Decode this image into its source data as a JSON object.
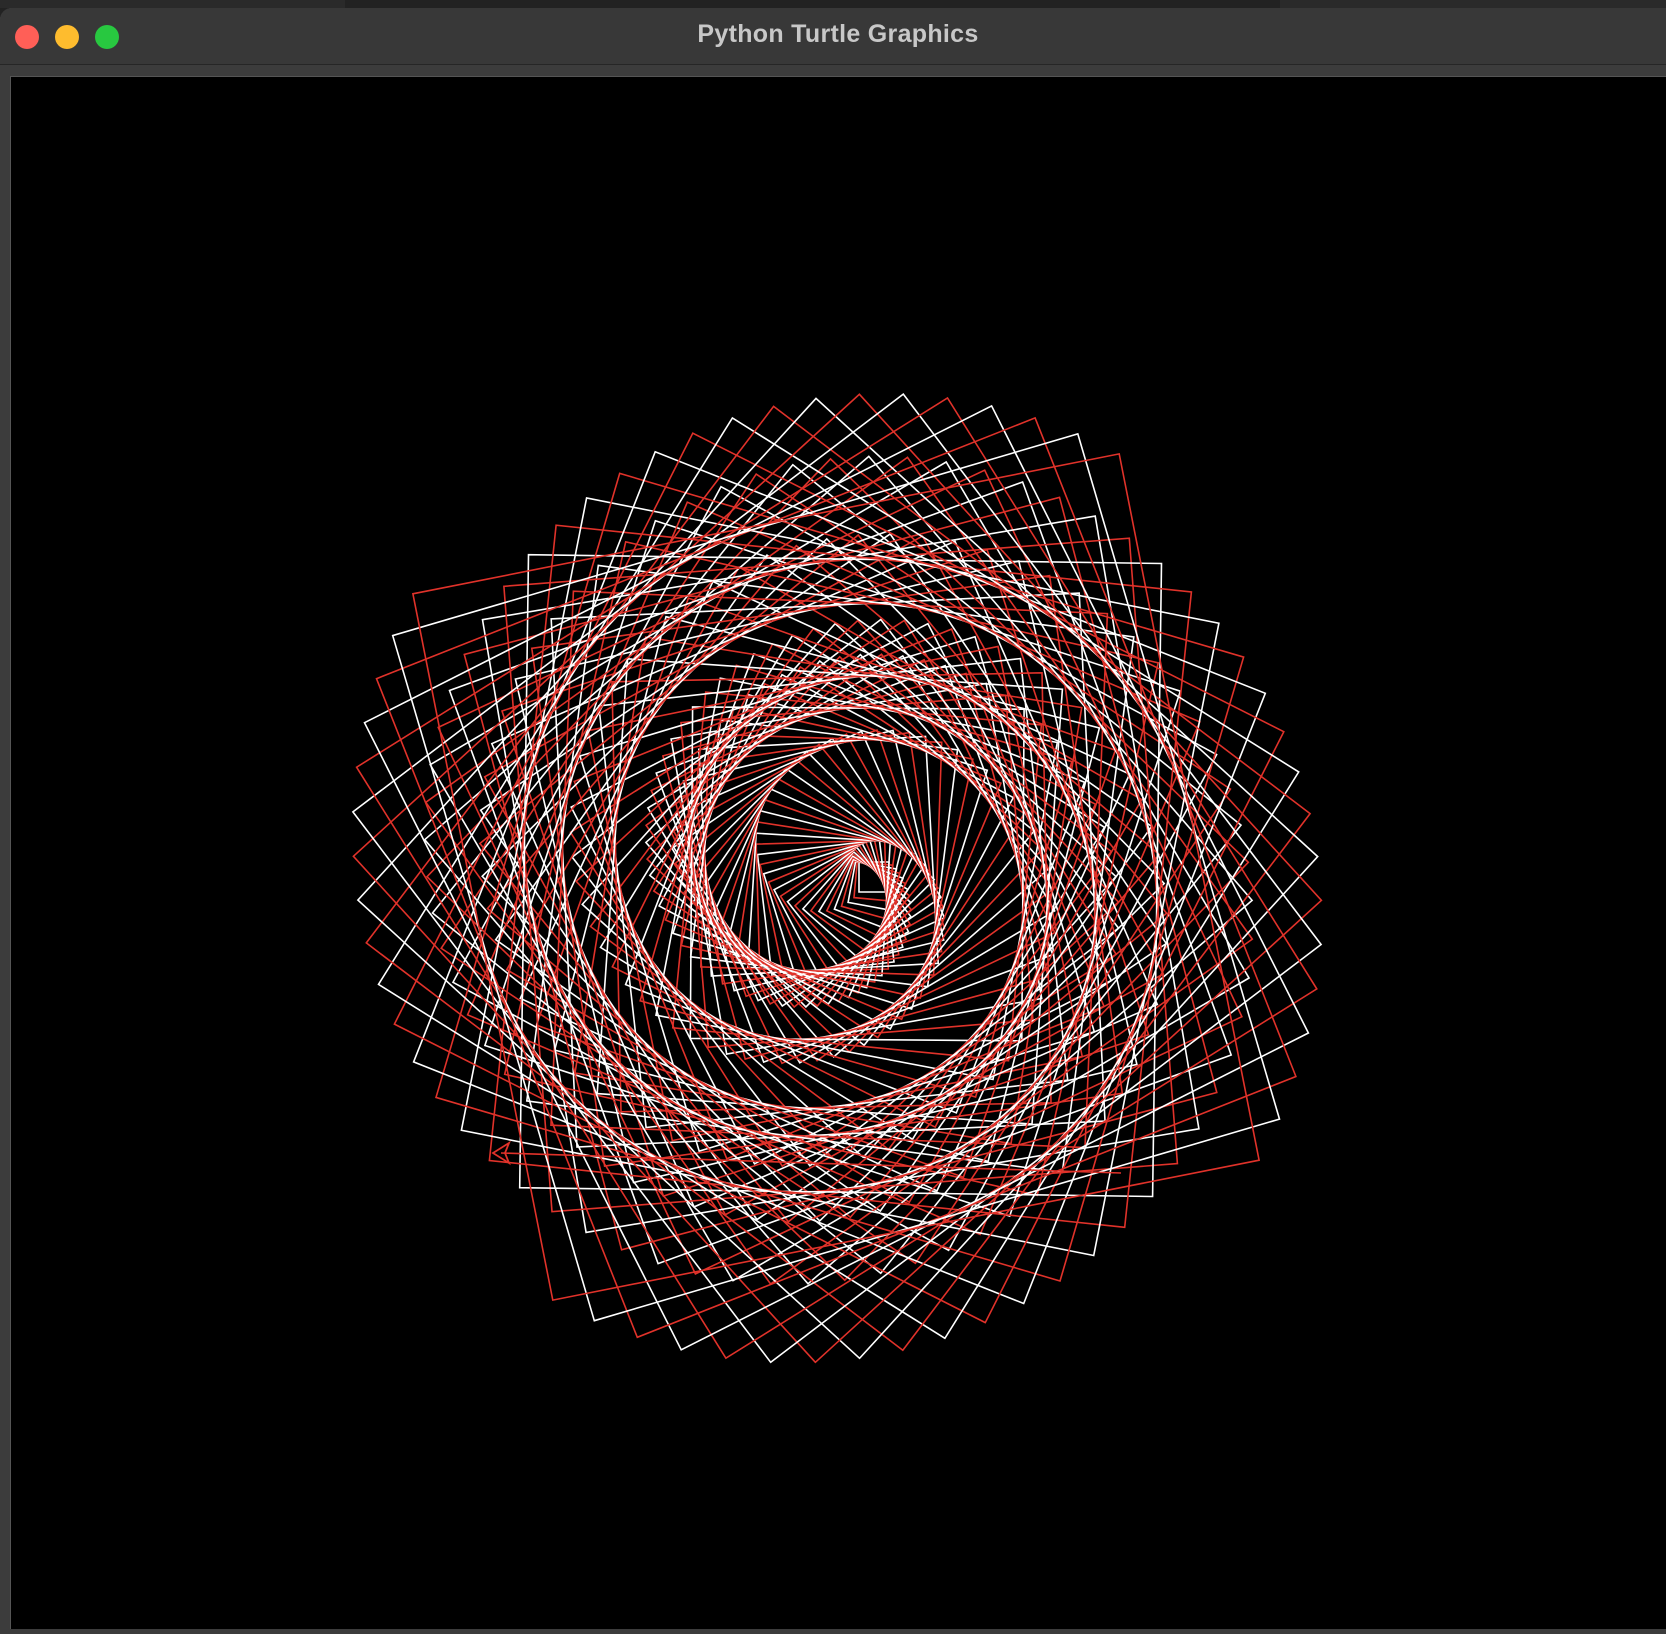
{
  "window": {
    "title": "Python Turtle Graphics"
  },
  "colors": {
    "background": "#000000",
    "pen_primary": "#ffffff",
    "pen_secondary": "#e0322a",
    "titlebar": "#383838",
    "title_text": "#c8c8c8",
    "close": "#ff5f57",
    "minimize": "#febc2e",
    "zoom": "#28c840"
  },
  "icons": {
    "close": "close-dot-icon",
    "minimize": "minimize-dot-icon",
    "zoom": "zoom-dot-icon",
    "turtle_cursor": "arrow-cursor-icon"
  }
}
